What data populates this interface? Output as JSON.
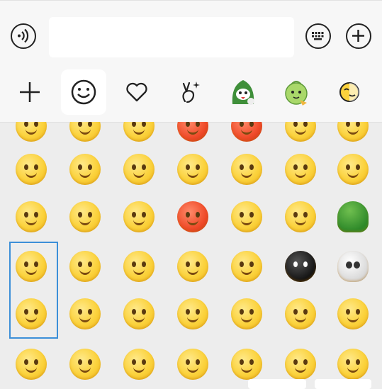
{
  "input_bar": {
    "voice_icon": "voice-icon",
    "message_value": "",
    "keyboard_icon": "keyboard-icon",
    "add_icon": "plus-circle-icon"
  },
  "tabs": [
    {
      "name": "tab-add",
      "icon": "plus-icon"
    },
    {
      "name": "tab-emoji",
      "icon": "smiley-icon",
      "active": true
    },
    {
      "name": "tab-favorites",
      "icon": "heart-icon"
    },
    {
      "name": "tab-gestures",
      "icon": "victory-hand-icon"
    },
    {
      "name": "tab-sticker-pack-1",
      "icon": "green-character-sticker-icon"
    },
    {
      "name": "tab-sticker-pack-2",
      "icon": "melon-character-sticker-icon"
    },
    {
      "name": "tab-sticker-pack-3",
      "icon": "yellow-face-sticker-icon"
    }
  ],
  "emoji_grid": {
    "rows": [
      [
        "sealed-mouth-face-icon",
        "face-partial-icon",
        "crying-face-icon",
        "angry-red-face-icon",
        "angry-red-face-icon",
        "red-face-icon",
        "grinning-teeth-face-icon"
      ],
      [
        "surprised-face-icon",
        "frowning-face-icon",
        "blushing-face-icon",
        "crying-loudly-face-icon",
        "drooling-face-icon",
        "laughing-hand-face-icon",
        "smiling-face-icon"
      ],
      [
        "shocked-face-icon",
        "rolling-eyes-face-icon",
        "dazed-face-icon",
        "angry-red-face-icon",
        "sweating-face-icon",
        "grinning-face-icon",
        "turtle-icon"
      ],
      [
        "headband-face-icon",
        "tongue-out-face-icon",
        "confused-face-icon",
        "shush-face-icon",
        "dizzy-face-icon",
        "black-bomb-face-icon",
        "skull-icon"
      ],
      [
        "hammer-icon",
        "thinking-face-icon",
        "nervous-face-icon",
        "pleading-face-icon",
        "shy-face-icon",
        "big-grin-face-icon",
        "sly-face-icon"
      ],
      [
        "kissing-face-icon",
        "facepalm-face-icon",
        "pouting-face-icon",
        "hugging-face-icon",
        "worried-face-icon",
        "happy-laugh-face-icon",
        "scheming-face-icon"
      ]
    ],
    "selected_group": [
      "headband-face-icon",
      "hammer-icon"
    ]
  },
  "colors": {
    "background": "#ededed",
    "bar": "#f7f7f7",
    "selection_border": "#3c8fd8",
    "emoji_yellow": "#fbd23c"
  }
}
